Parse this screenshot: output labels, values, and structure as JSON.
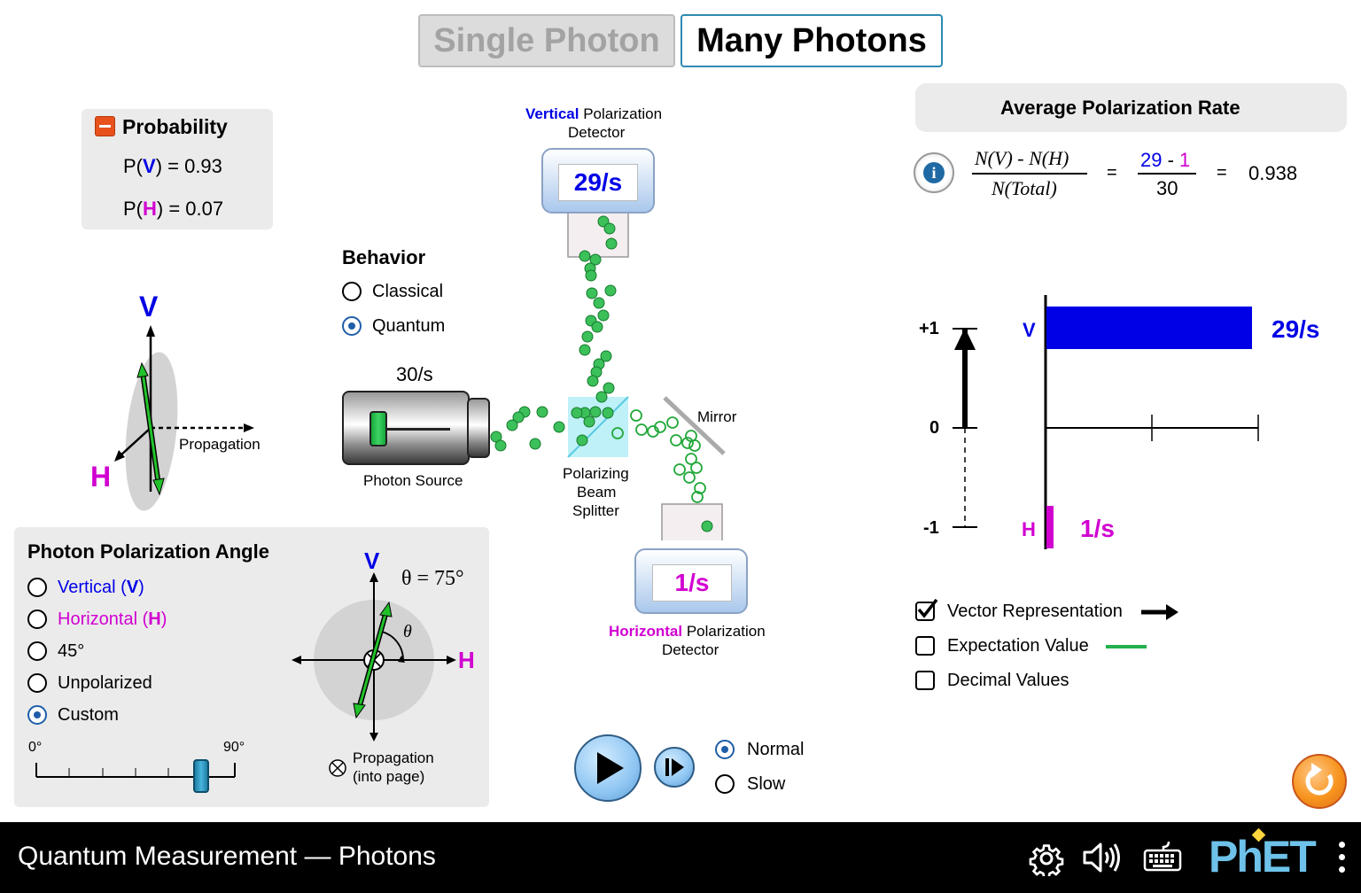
{
  "tabs": {
    "single": "Single Photon",
    "many": "Many Photons"
  },
  "probability": {
    "title": "Probability",
    "pv_prefix": "P(",
    "v": "V",
    "pv_suffix": ") = 0.93",
    "ph_prefix": "P(",
    "h": "H",
    "ph_suffix": ") = 0.07"
  },
  "vector_diagram": {
    "v": "V",
    "h": "H",
    "propagation": "Propagation"
  },
  "behavior": {
    "title": "Behavior",
    "options": [
      "Classical",
      "Quantum"
    ],
    "selected": "Quantum"
  },
  "source": {
    "rate": "30/s",
    "label": "Photon Source"
  },
  "vertical_detector": {
    "label_colored": "Vertical",
    "label_rest": " Polarization",
    "label_line2": "Detector",
    "rate": "29/s"
  },
  "horizontal_detector": {
    "label_colored": "Horizontal",
    "label_rest": " Polarization",
    "label_line2": "Detector",
    "rate": "1/s"
  },
  "beam_splitter": {
    "line1": "Polarizing",
    "line2": "Beam",
    "line3": "Splitter"
  },
  "mirror": "Mirror",
  "angle_panel": {
    "title": "Photon Polarization Angle",
    "options": [
      {
        "pre": "Vertical (",
        "bold": "V",
        "post": ")"
      },
      {
        "pre": "Horizontal (",
        "bold": "H",
        "post": ")"
      },
      {
        "pre": "45°",
        "bold": "",
        "post": ""
      },
      {
        "pre": "Unpolarized",
        "bold": "",
        "post": ""
      },
      {
        "pre": "Custom",
        "bold": "",
        "post": ""
      }
    ],
    "selected_index": 4,
    "slider_min": "0°",
    "slider_max": "90°",
    "slider_value_deg": 75,
    "v": "V",
    "h": "H",
    "theta_readout": "θ = 75°",
    "theta": "θ",
    "propagation_line1": "Propagation",
    "propagation_line2": "(into page)"
  },
  "playback": {
    "speeds": [
      "Normal",
      "Slow"
    ],
    "selected": "Normal"
  },
  "rate_panel": {
    "title": "Average Polarization Rate",
    "num_text": "N(V) - N(H)",
    "den_text": "N(Total)",
    "eq1": "=",
    "num_v": "29",
    "minus": " - ",
    "num_h": "1",
    "den": "30",
    "eq2": "=",
    "result": "0.938"
  },
  "rate_chart": {
    "ticks": [
      "+1",
      "0",
      "-1"
    ],
    "v_label": "V",
    "v_rate": "29/s",
    "v_fraction": 0.967,
    "h_label": "H",
    "h_rate": "1/s",
    "h_fraction": 0.033
  },
  "checkboxes": [
    {
      "label": "Vector Representation",
      "checked": true
    },
    {
      "label": "Expectation Value",
      "checked": false
    },
    {
      "label": "Decimal Values",
      "checked": false
    }
  ],
  "footer": {
    "title": "Quantum Measurement — Photons",
    "logo": "PhET"
  },
  "colors": {
    "v_blue": "#0000e6",
    "h_magenta": "#d100d1",
    "photon_green": "#22b14c",
    "tab_border": "#2c8bb3"
  }
}
